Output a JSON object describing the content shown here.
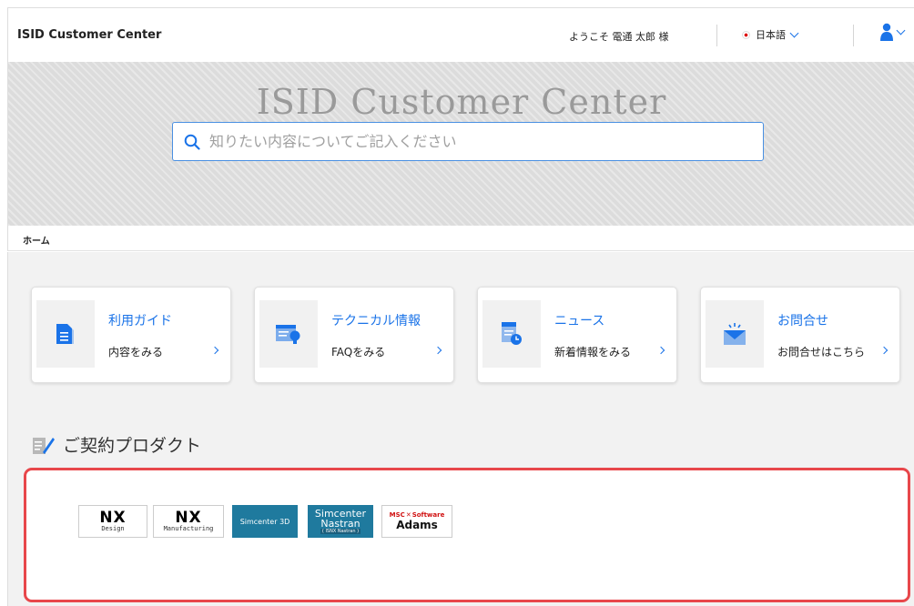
{
  "header": {
    "app_title": "ISID Customer Center",
    "welcome": "ようこそ 電通 太郎 様",
    "language": "日本語"
  },
  "hero": {
    "title": "ISID Customer Center",
    "search_placeholder": "知りたい内容についてご記入ください"
  },
  "breadcrumb": {
    "home": "ホーム"
  },
  "cards": [
    {
      "title": "利用ガイド",
      "sub": "内容をみる",
      "icon": "document-icon"
    },
    {
      "title": "テクニカル情報",
      "sub": "FAQをみる",
      "icon": "browser-bulb-icon"
    },
    {
      "title": "ニュース",
      "sub": "新着情報をみる",
      "icon": "news-clock-icon"
    },
    {
      "title": "お問合せ",
      "sub": "お問合せはこちら",
      "icon": "mail-icon"
    }
  ],
  "products": {
    "section_title": "ご契約プロダクト",
    "logos": [
      {
        "main": "NX",
        "sub": "Design"
      },
      {
        "main": "NX",
        "sub": "Manufacturing"
      },
      {
        "main": "Simcenter 3D"
      },
      {
        "main": "Simcenter",
        "sub": "Nastran",
        "sub2": "( ISNX Nastran )"
      },
      {
        "brand1": "MSC",
        "brand2": "Software",
        "main": "Adams"
      }
    ]
  },
  "colors": {
    "accent": "#1a73e8",
    "highlight": "#e8474b",
    "simcenter": "#1f7a9e"
  }
}
